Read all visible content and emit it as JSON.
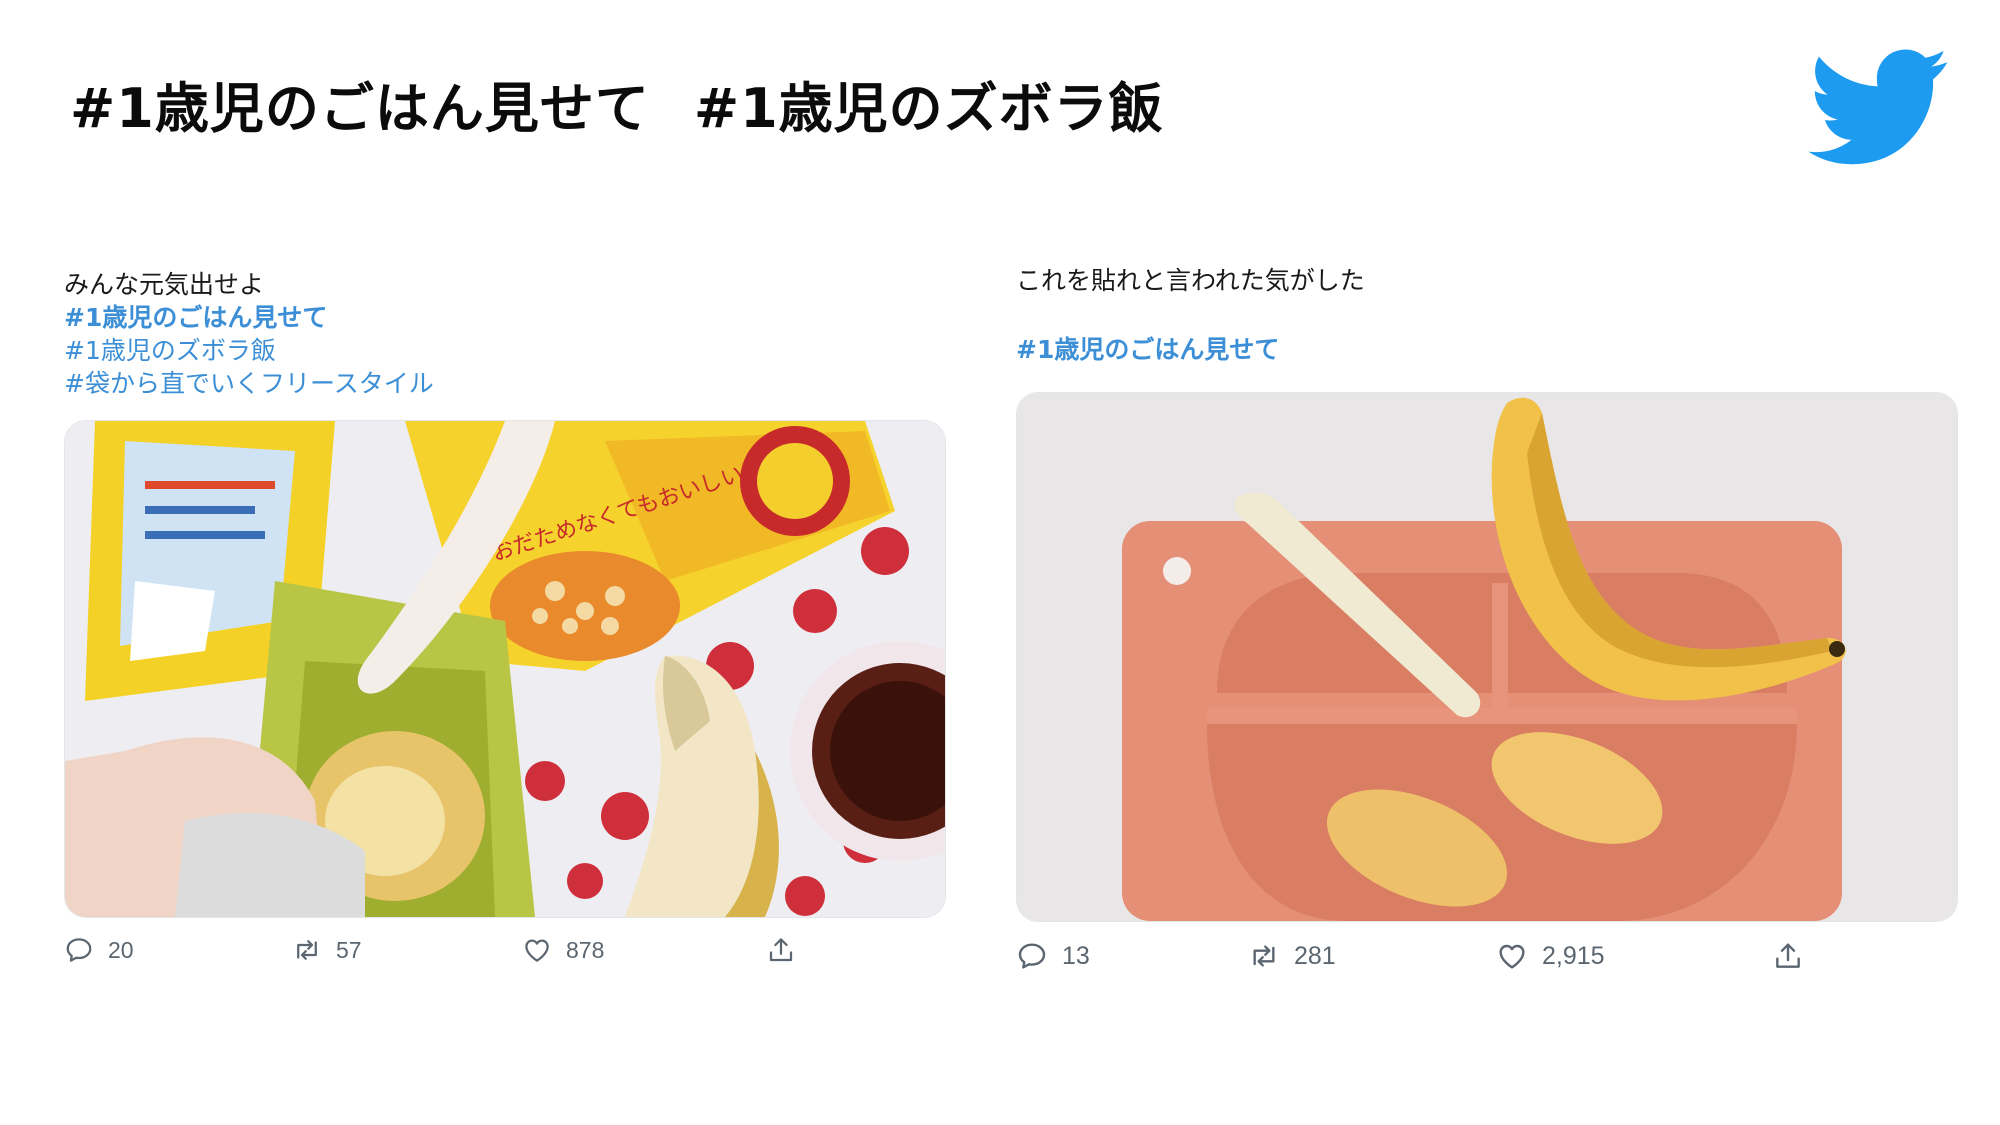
{
  "heading": {
    "tag_1": "#1歳児のごはん見せて",
    "tag_2": "#1歳児のズボラ飯"
  },
  "brand": {
    "logo_icon": "twitter-bird-icon",
    "color": "#1d9bf0"
  },
  "colors": {
    "hashtag": "#3c8fd6",
    "action_gray": "#5b6670"
  },
  "tweets": [
    {
      "text_lines": [
        "みんな元気出せよ",
        "#1歳児のごはん見せて",
        "#1歳児のズボラ飯",
        "#袋から直でいくフリースタイル"
      ],
      "box_text": "おだためなくてもおいしい!",
      "metrics": {
        "replies": "20",
        "retweets": "57",
        "likes": "878"
      }
    },
    {
      "text_lines": [
        "これを貼れと言われた気がした",
        "#1歳児のごはん見せて"
      ],
      "metrics": {
        "replies": "13",
        "retweets": "281",
        "likes": "2,915"
      }
    }
  ],
  "icons": {
    "reply": "reply-icon",
    "retweet": "retweet-icon",
    "like": "heart-icon",
    "share": "share-icon"
  }
}
